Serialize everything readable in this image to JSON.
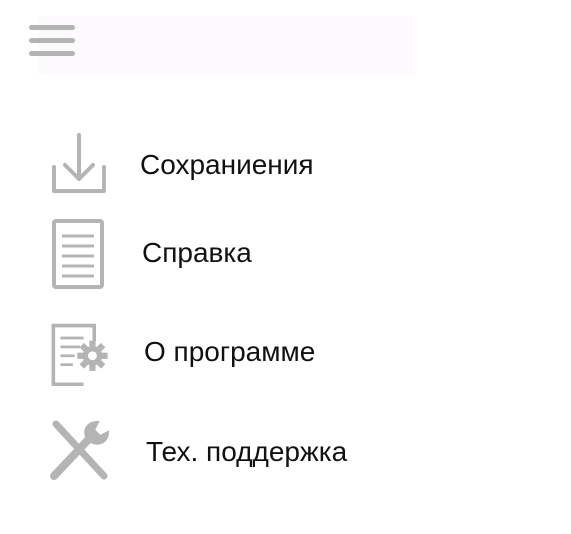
{
  "header": {
    "menu_icon": "hamburger-menu-icon"
  },
  "menu": {
    "items": [
      {
        "label": "Сохраниения",
        "icon": "download-icon"
      },
      {
        "label": "Справка",
        "icon": "document-icon"
      },
      {
        "label": "О программе",
        "icon": "document-settings-icon"
      },
      {
        "label": "Тех. поддержка",
        "icon": "tools-icon"
      }
    ]
  },
  "colors": {
    "icon_gray": "#b4b4b4",
    "text": "#111111",
    "background": "#ffffff"
  }
}
